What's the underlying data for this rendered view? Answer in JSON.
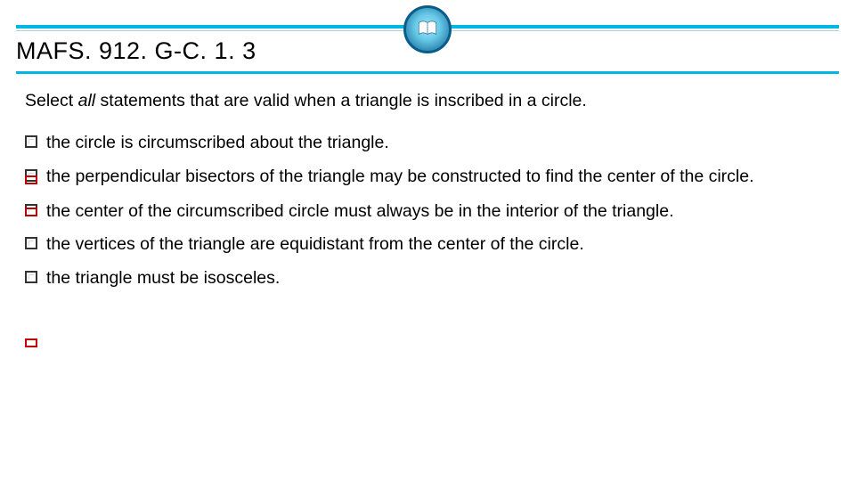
{
  "header": {
    "title": "MAFS. 912. G-C. 1. 3"
  },
  "prompt": {
    "pre": "Select ",
    "em": "all",
    "post": " statements that are valid when a triangle is inscribed in a circle."
  },
  "options": [
    "the circle is circumscribed about the triangle.",
    "the perpendicular bisectors of the triangle may be constructed to find the center of the circle.",
    "the center of the circumscribed circle must always be in the interior of the triangle.",
    "the vertices of the triangle are equidistant from the center of the circle.",
    "the triangle must be isosceles."
  ]
}
